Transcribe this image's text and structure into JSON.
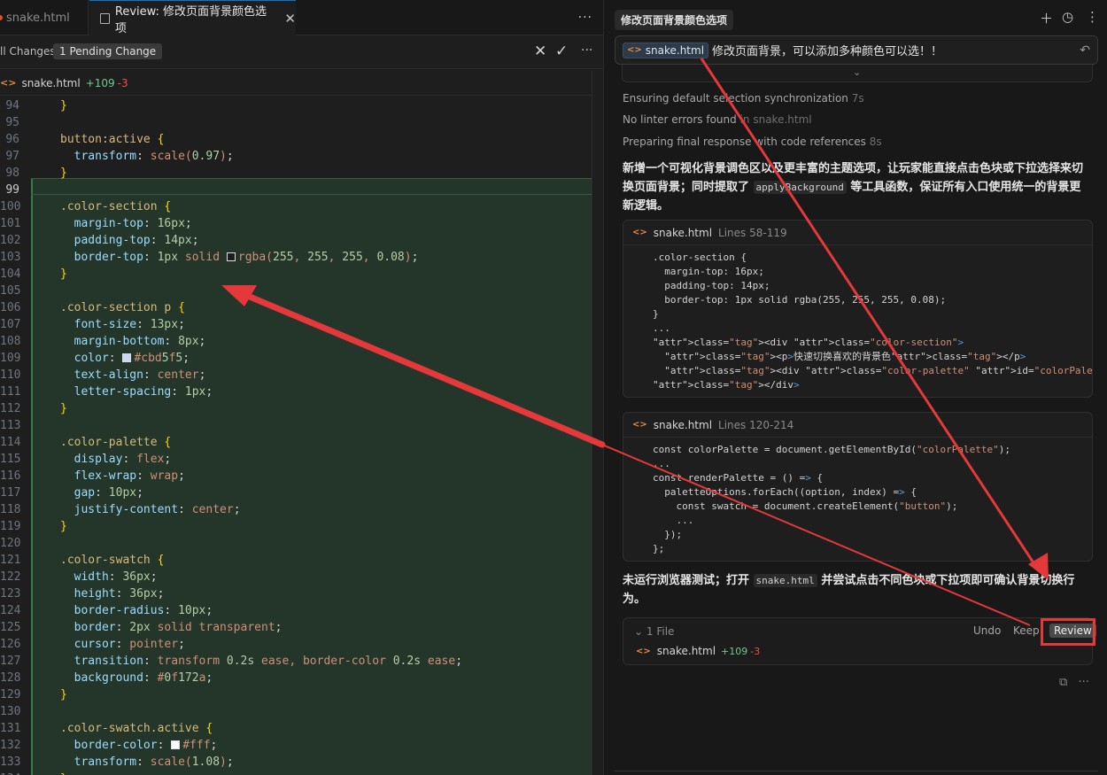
{
  "editor": {
    "tabs": [
      {
        "label": "snake.html"
      },
      {
        "label": "Review: 修改页面背景颜色选项"
      }
    ],
    "changebar": {
      "all_changes": "ll Changes",
      "pending": "1 Pending Change"
    },
    "file_header": {
      "name": "snake.html",
      "added": "+109",
      "removed": "-3"
    },
    "code_lines": [
      {
        "n": "94",
        "t": "  }"
      },
      {
        "n": "95",
        "t": ""
      },
      {
        "n": "96",
        "t": "  button:active {"
      },
      {
        "n": "97",
        "t": "    transform: scale(0.97);"
      },
      {
        "n": "98",
        "t": "  }"
      },
      {
        "n": "99",
        "t": ""
      },
      {
        "n": "100",
        "t": "  .color-section {"
      },
      {
        "n": "101",
        "t": "    margin-top: 16px;"
      },
      {
        "n": "102",
        "t": "    padding-top: 14px;"
      },
      {
        "n": "103",
        "t": "    border-top: 1px solid rgba(255, 255, 255, 0.08);"
      },
      {
        "n": "104",
        "t": "  }"
      },
      {
        "n": "105",
        "t": ""
      },
      {
        "n": "106",
        "t": "  .color-section p {"
      },
      {
        "n": "107",
        "t": "    font-size: 13px;"
      },
      {
        "n": "108",
        "t": "    margin-bottom: 8px;"
      },
      {
        "n": "109",
        "t": "    color: #cbd5f5;"
      },
      {
        "n": "110",
        "t": "    text-align: center;"
      },
      {
        "n": "111",
        "t": "    letter-spacing: 1px;"
      },
      {
        "n": "112",
        "t": "  }"
      },
      {
        "n": "113",
        "t": ""
      },
      {
        "n": "114",
        "t": "  .color-palette {"
      },
      {
        "n": "115",
        "t": "    display: flex;"
      },
      {
        "n": "116",
        "t": "    flex-wrap: wrap;"
      },
      {
        "n": "117",
        "t": "    gap: 10px;"
      },
      {
        "n": "118",
        "t": "    justify-content: center;"
      },
      {
        "n": "119",
        "t": "  }"
      },
      {
        "n": "120",
        "t": ""
      },
      {
        "n": "121",
        "t": "  .color-swatch {"
      },
      {
        "n": "122",
        "t": "    width: 36px;"
      },
      {
        "n": "123",
        "t": "    height: 36px;"
      },
      {
        "n": "124",
        "t": "    border-radius: 10px;"
      },
      {
        "n": "125",
        "t": "    border: 2px solid transparent;"
      },
      {
        "n": "126",
        "t": "    cursor: pointer;"
      },
      {
        "n": "127",
        "t": "    transition: transform 0.2s ease, border-color 0.2s ease;"
      },
      {
        "n": "128",
        "t": "    background: #0f172a;"
      },
      {
        "n": "129",
        "t": "  }"
      },
      {
        "n": "130",
        "t": ""
      },
      {
        "n": "131",
        "t": "  .color-swatch.active {"
      },
      {
        "n": "132",
        "t": "    border-color: #fff;"
      },
      {
        "n": "133",
        "t": "    transform: scale(1.08);"
      },
      {
        "n": "134",
        "t": "  }"
      }
    ],
    "swatch_colors": {
      "line_103": "#1e1e1e",
      "line_109": "#cbd5f5",
      "line_128": "#0f172a",
      "line_132": "#ffffff"
    }
  },
  "chat": {
    "title": "修改页面背景颜色选项",
    "prompt": {
      "chip": "snake.html",
      "text": "修改页面背景，可以添加多种颜色可以选！！"
    },
    "status": [
      {
        "text": "Ensuring default selection synchronization",
        "dim": "7s"
      },
      {
        "text": "No linter errors found",
        "dim": "in snake.html"
      },
      {
        "text": "Preparing final response with code references",
        "dim": "8s"
      }
    ],
    "summary": {
      "part1": "新增一个可视化背景调色区以及更丰富的主题选项，让玩家能直接点击色块或下拉选择来切换页面背景；同时提取了",
      "code": "applyBackground",
      "part2": "等工具函数，保证所有入口使用统一的背景更新逻辑。"
    },
    "cards": [
      {
        "file": "snake.html",
        "lines": "Lines 58-119",
        "code": [
          ".color-section {",
          "  margin-top: 16px;",
          "  padding-top: 14px;",
          "  border-top: 1px solid rgba(255, 255, 255, 0.08);",
          "}",
          "...",
          "<div class=\"color-section\">",
          "  <p>快速切换喜欢的背景色</p>",
          "  <div class=\"color-palette\" id=\"colorPalette\"></div>",
          "</div>"
        ]
      },
      {
        "file": "snake.html",
        "lines": "Lines 120-214",
        "code": [
          "const colorPalette = document.getElementById(\"colorPalette\");",
          "...",
          "const renderPalette = () => {",
          "  paletteOptions.forEach((option, index) => {",
          "    const swatch = document.createElement(\"button\");",
          "    ...",
          "  });",
          "};"
        ]
      }
    ],
    "tail": {
      "part1": "未运行浏览器测试；打开",
      "code": "snake.html",
      "part2": "并尝试点击不同色块或下拉项即可确认背景切换行为。"
    },
    "files": {
      "count": "1 File",
      "undo": "Undo",
      "keep": "Keep",
      "review": "Review",
      "file": "snake.html",
      "added": "+109",
      "removed": "-3"
    }
  },
  "annotation_color": "#e5383b"
}
